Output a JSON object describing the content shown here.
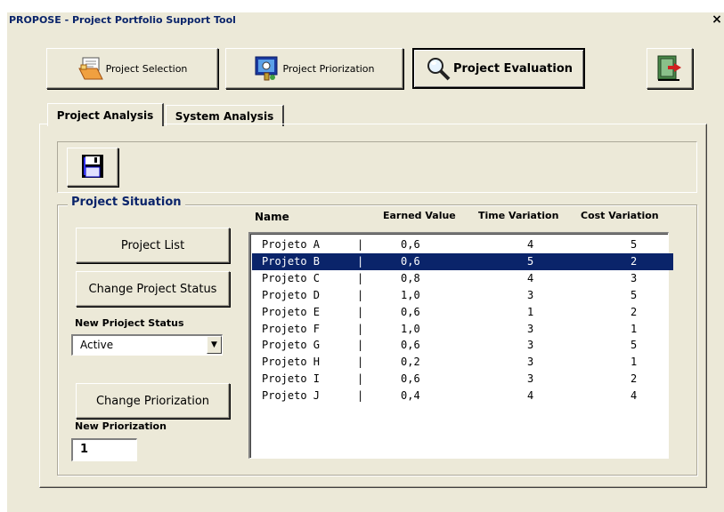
{
  "window": {
    "title": "PROPOSE - Project Portfolio Support Tool",
    "close_glyph": "×"
  },
  "toolbar": {
    "project_selection": "Project Selection",
    "project_priorization": "Project Priorization",
    "project_evaluation": "Project Evaluation",
    "exit_icon": "exit-door-icon"
  },
  "tabs": [
    {
      "label": "Project Analysis",
      "selected": true
    },
    {
      "label": "System Analysis",
      "selected": false
    }
  ],
  "save_icon": "floppy-disk-icon",
  "situation": {
    "group_label": "Project Situation",
    "project_list_button": "Project List",
    "change_status_button": "Change Project Status",
    "new_status_label": "New Prioject Status",
    "status_value": "Active",
    "change_priorization_button": "Change Priorization",
    "new_priorization_label": "New Priorization",
    "priorization_value": "1"
  },
  "table": {
    "headers": {
      "name": "Name",
      "earned_value": "Earned Value",
      "time_variation": "Time Variation",
      "cost_variation": "Cost Variation"
    },
    "separator": "|",
    "selected_index": 1,
    "rows": [
      {
        "name": "Projeto A",
        "earned_value": "0,6",
        "time_variation": "4",
        "cost_variation": "5"
      },
      {
        "name": "Projeto B",
        "earned_value": "0,6",
        "time_variation": "5",
        "cost_variation": "2"
      },
      {
        "name": "Projeto C",
        "earned_value": "0,8",
        "time_variation": "4",
        "cost_variation": "3"
      },
      {
        "name": "Projeto D",
        "earned_value": "1,0",
        "time_variation": "3",
        "cost_variation": "5"
      },
      {
        "name": "Projeto E",
        "earned_value": "0,6",
        "time_variation": "1",
        "cost_variation": "2"
      },
      {
        "name": "Projeto F",
        "earned_value": "1,0",
        "time_variation": "3",
        "cost_variation": "1"
      },
      {
        "name": "Projeto G",
        "earned_value": "0,6",
        "time_variation": "3",
        "cost_variation": "5"
      },
      {
        "name": "Projeto H",
        "earned_value": "0,2",
        "time_variation": "3",
        "cost_variation": "1"
      },
      {
        "name": "Projeto I",
        "earned_value": "0,6",
        "time_variation": "3",
        "cost_variation": "2"
      },
      {
        "name": "Projeto J",
        "earned_value": "0,4",
        "time_variation": "4",
        "cost_variation": "4"
      }
    ]
  },
  "colors": {
    "title_text": "#0a246a",
    "selection": "#0a246a",
    "face": "#ece9d8"
  }
}
